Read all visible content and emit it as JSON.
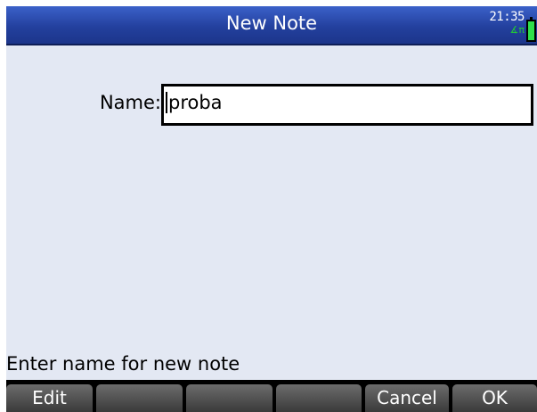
{
  "title_bar": {
    "title": "New Note",
    "clock": "21:35",
    "angle_mode": "∡π",
    "battery_icon": "battery-icon"
  },
  "form": {
    "name_label": "Name:",
    "name_value": "proba"
  },
  "status": "Enter name for new note",
  "softkeys": [
    "Edit",
    "",
    "",
    "",
    "Cancel",
    "OK"
  ],
  "colors": {
    "title_bar": "#23409e",
    "background": "#e3e8f3",
    "softkey": "#4a4a4a",
    "battery": "#2fe04a"
  }
}
